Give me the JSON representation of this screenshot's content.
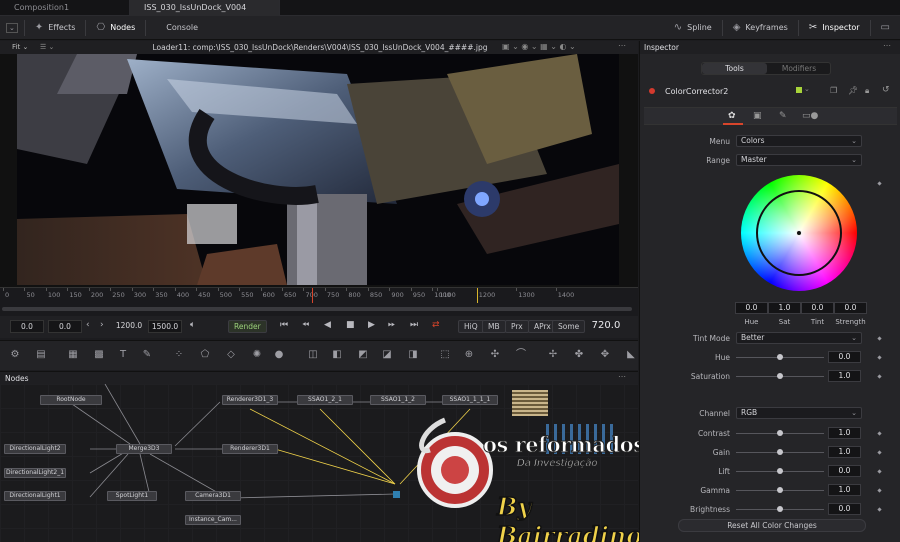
{
  "tabs": [
    {
      "label": "Composition1",
      "active": false
    },
    {
      "label": "ISS_030_IssUnDock_V004",
      "active": true
    }
  ],
  "toolbar": {
    "effects": "Effects",
    "nodes": "Nodes",
    "console": "Console",
    "spline": "Spline",
    "keyframes": "Keyframes",
    "inspector": "Inspector"
  },
  "viewer": {
    "fit_label": "Fit",
    "title": "Loader11: comp:\\ISS_030_IssUnDock\\Renders\\V004\\ISS_030_IssUnDock_V004_####.jpg"
  },
  "timeline": {
    "ticks": [
      "0",
      "50",
      "100",
      "150",
      "200",
      "250",
      "300",
      "350",
      "400",
      "450",
      "500",
      "550",
      "600",
      "650",
      "700",
      "750",
      "800",
      "850",
      "900",
      "950",
      "1000",
      "1100",
      "1200",
      "1300",
      "1400"
    ],
    "playhead_frame": 720,
    "marker_frame": 1200
  },
  "transport": {
    "start": "0.0",
    "render_start": "0.0",
    "render_end": "1200.0",
    "end": "1500.0",
    "render_label": "Render",
    "hiq": "HiQ",
    "mb": "MB",
    "prx": "Prx",
    "aprx": "APrx",
    "some": "Some",
    "current_frame": "720.0"
  },
  "nodes_panel": {
    "title": "Nodes",
    "nodes": [
      {
        "id": "rootnode",
        "label": "RootNode"
      },
      {
        "id": "directionallight2",
        "label": "DirectionalLight2"
      },
      {
        "id": "directionallight2_1",
        "label": "DirectionalLight2_1"
      },
      {
        "id": "directionallight1",
        "label": "DirectionalLight1"
      },
      {
        "id": "merge3d3",
        "label": "Merge3D3"
      },
      {
        "id": "spotlight1",
        "label": "SpotLight1"
      },
      {
        "id": "camera3d1",
        "label": "Camera3D1"
      },
      {
        "id": "instance_cam",
        "label": "Instance_Cam..."
      },
      {
        "id": "renderer3d1_3",
        "label": "Renderer3D1_3"
      },
      {
        "id": "renderer3d1",
        "label": "Renderer3D1"
      },
      {
        "id": "ssao1_2_1",
        "label": "SSAO1_2_1"
      },
      {
        "id": "ssao1_1_2",
        "label": "SSAO1_1_2"
      },
      {
        "id": "ssao1_1_1_1",
        "label": "SSAO1_1_1_1"
      }
    ]
  },
  "inspector": {
    "title": "Inspector",
    "tab_tools": "Tools",
    "tab_modifiers": "Modifiers",
    "tool_name": "ColorCorrector2",
    "menu_label": "Menu",
    "menu_value": "Colors",
    "range_label": "Range",
    "range_value": "Master",
    "wheel_values": [
      {
        "label": "Hue",
        "value": "0.0"
      },
      {
        "label": "Sat",
        "value": "1.0"
      },
      {
        "label": "Tint",
        "value": "0.0"
      },
      {
        "label": "Strength",
        "value": "0.0"
      }
    ],
    "tint_mode_label": "Tint Mode",
    "tint_mode_value": "Better",
    "hue_label": "Hue",
    "hue_value": "0.0",
    "saturation_label": "Saturation",
    "saturation_value": "1.0",
    "channel_label": "Channel",
    "channel_value": "RGB",
    "sliders": [
      {
        "label": "Contrast",
        "value": "1.0",
        "fraction": 0.5
      },
      {
        "label": "Gain",
        "value": "1.0",
        "fraction": 0.5
      },
      {
        "label": "Lift",
        "value": "0.0",
        "fraction": 0.5
      },
      {
        "label": "Gamma",
        "value": "1.0",
        "fraction": 0.5
      },
      {
        "label": "Brightness",
        "value": "0.0",
        "fraction": 0.5
      }
    ],
    "reset_label": "Reset All Color Changes"
  },
  "watermark": {
    "line1": "os reformados",
    "line2": "Da Investigação",
    "line3": "By Bairradino"
  },
  "colors": {
    "accent_orange": "#d8452b",
    "tool_swatch": "#d43a2e",
    "link_yellow": "#f0d24a",
    "node_blue": "#2f5f74"
  }
}
